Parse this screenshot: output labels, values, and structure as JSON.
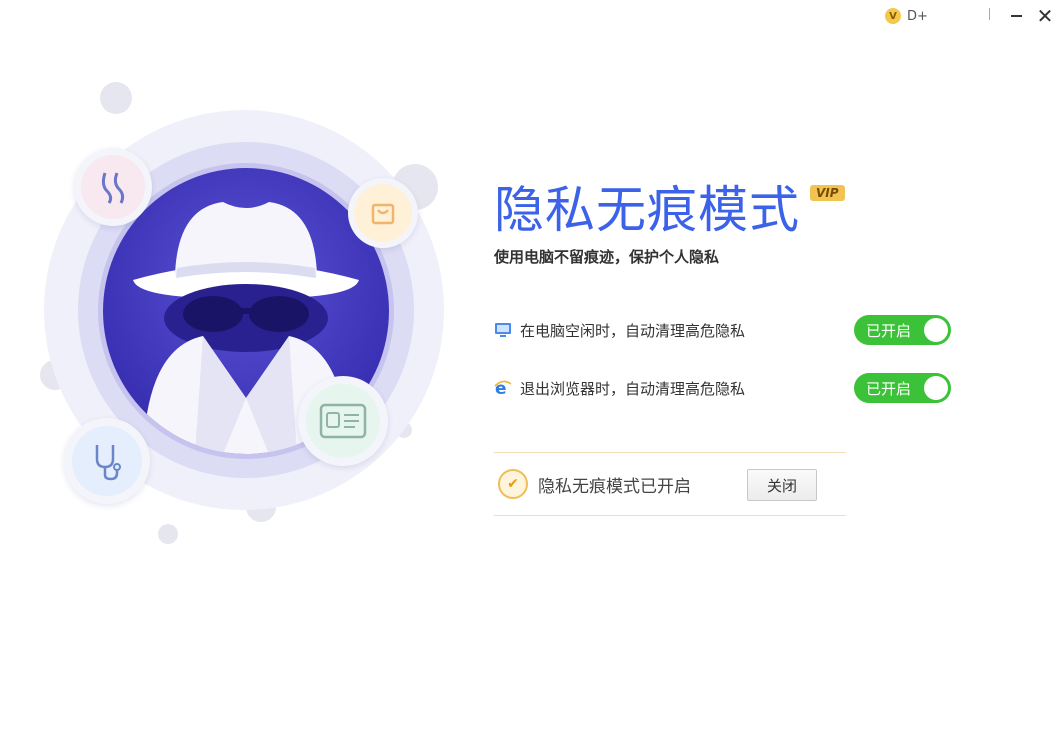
{
  "titlebar": {
    "vip_coin": "V",
    "user_label": "D+",
    "minimize_icon": "minimize-icon",
    "close_icon": "close-icon",
    "close_glyph": "✕"
  },
  "main": {
    "title": "隐私无痕模式",
    "vip_tag": "VIP",
    "subtitle": "使用电脑不留痕迹，保护个人隐私",
    "settings": [
      {
        "icon": "monitor-icon",
        "label": "在电脑空闲时，自动清理高危隐私",
        "toggle_label": "已开启",
        "enabled": true
      },
      {
        "icon": "ie-browser-icon",
        "label": "退出浏览器时，自动清理高危隐私",
        "toggle_label": "已开启",
        "enabled": true
      }
    ],
    "status": {
      "icon": "check-icon",
      "text": "隐私无痕模式已开启",
      "close_button": "关闭"
    }
  },
  "colors": {
    "title_blue": "#3b62e8",
    "toggle_green": "#3cc238",
    "disc_purple": "#3a30b4",
    "accent_gold": "#f0bd57"
  }
}
